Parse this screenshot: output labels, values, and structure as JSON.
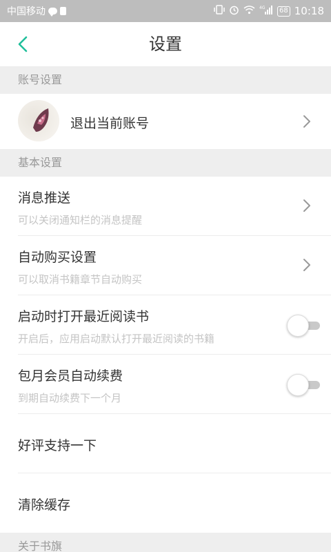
{
  "status_bar": {
    "carrier": "中国移动",
    "battery": "68",
    "time": "10:18",
    "network": "4G"
  },
  "header": {
    "title": "设置"
  },
  "sections": {
    "account": "账号设置",
    "basic": "基本设置",
    "about": "关于书旗"
  },
  "account_row": {
    "label": "退出当前账号"
  },
  "rows": {
    "push": {
      "title": "消息推送",
      "subtitle": "可以关闭通知栏的消息提醒"
    },
    "auto_buy": {
      "title": "自动购买设置",
      "subtitle": "可以取消书籍章节自动购买"
    },
    "open_recent": {
      "title": "启动时打开最近阅读书",
      "subtitle": "开启后，应用启动默认打开最近阅读的书籍",
      "enabled": false
    },
    "auto_renew": {
      "title": "包月会员自动续费",
      "subtitle": "到期自动续费下一个月",
      "enabled": false
    },
    "rate": {
      "title": "好评支持一下"
    },
    "clear_cache": {
      "title": "清除缓存"
    }
  },
  "colors": {
    "accent": "#1fbf9a",
    "section_bg": "#eeeeee"
  }
}
